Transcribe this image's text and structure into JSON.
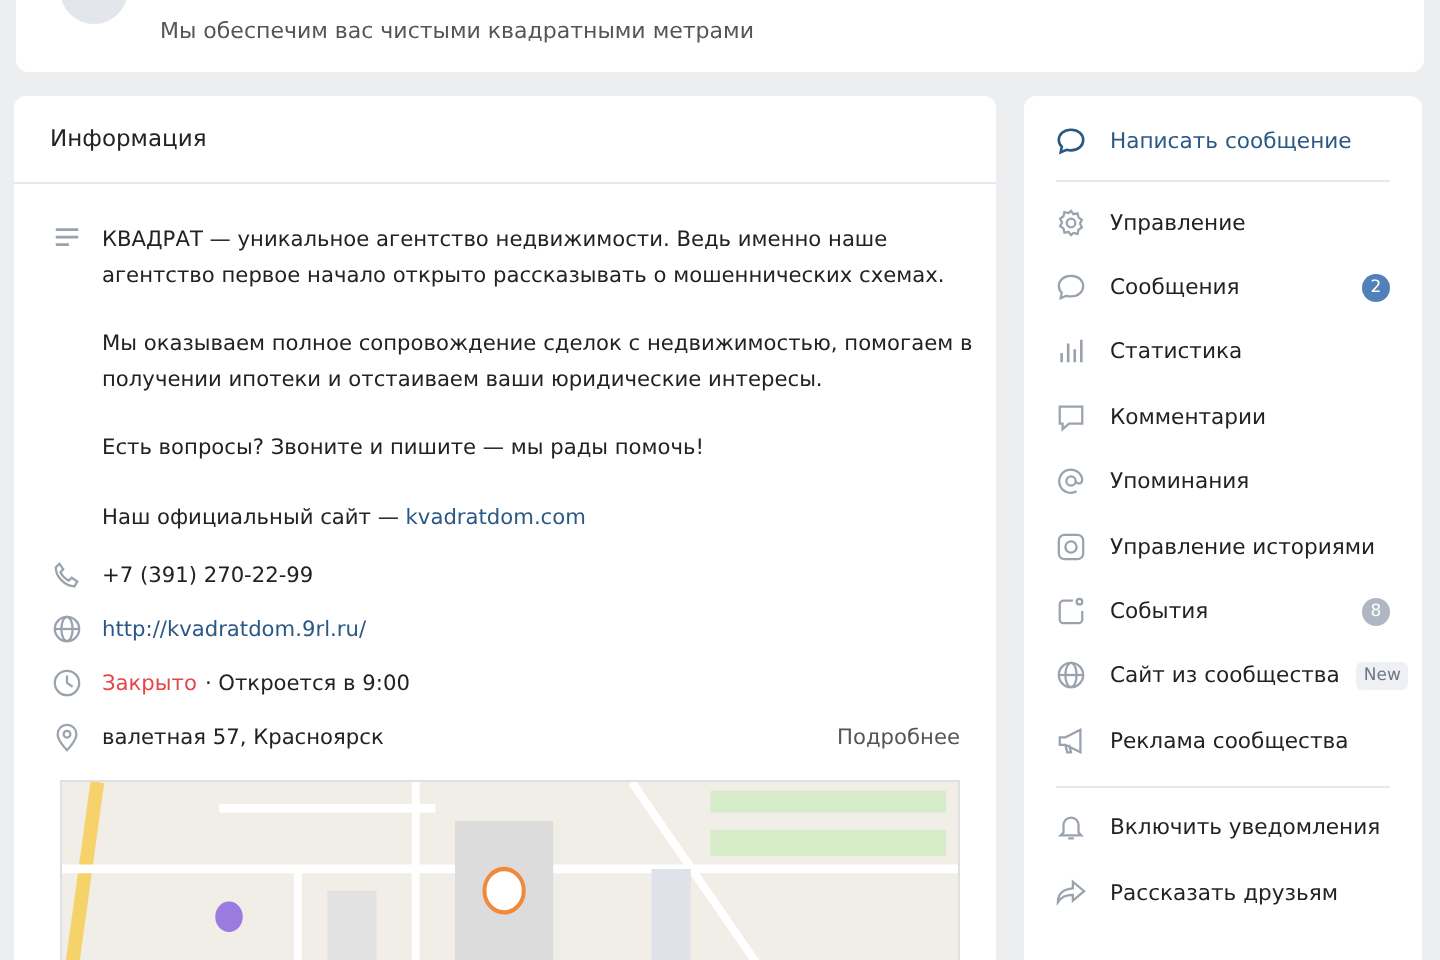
{
  "header": {
    "subtitle": "Мы обеспечим вас чистыми квадратными метрами"
  },
  "info": {
    "title": "Информация",
    "paragraphs": [
      "КВАДРАТ — уникальное агентство недвижимости. Ведь именно наше агентство первое начало открыто рассказывать о мошеннических схемах.",
      "Мы оказываем полное сопровождение сделок с недвижимостью, помогаем в получении ипотеки и отстаиваем ваши юридические интересы.",
      "Есть вопросы? Звоните и пишите — мы рады помочь!"
    ],
    "site_label": "Наш официальный сайт —",
    "site_link": "kvadratdom.com",
    "contacts": [
      {
        "kind": "phone",
        "text": "+7 (391) 270-22-99"
      },
      {
        "kind": "web",
        "text": "http://kvadratdom.9rl.ru/"
      },
      {
        "kind": "hours",
        "status": "Закрыто",
        "text": "· Откроется в 9:00"
      },
      {
        "kind": "address",
        "text": "валетная 57, Красноярск",
        "more": "Подробнее"
      }
    ]
  },
  "menu": {
    "primary": {
      "label": "Написать сообщение"
    },
    "groups": [
      [
        {
          "kind": "gear",
          "label": "Управление"
        },
        {
          "kind": "chat",
          "label": "Сообщения",
          "badge": {
            "kind": "count",
            "text": "2"
          }
        },
        {
          "kind": "chart",
          "label": "Статистика"
        },
        {
          "kind": "comment",
          "label": "Комментарии"
        },
        {
          "kind": "at",
          "label": "Упоминания"
        },
        {
          "kind": "stories",
          "label": "Управление историями"
        },
        {
          "kind": "events",
          "label": "События",
          "badge": {
            "kind": "muted",
            "text": "8"
          }
        },
        {
          "kind": "globe",
          "label": "Сайт из сообщества",
          "badge": {
            "kind": "new",
            "text": "New"
          }
        },
        {
          "kind": "megaphone",
          "label": "Реклама сообщества"
        }
      ],
      [
        {
          "kind": "bell",
          "label": "Включить уведомления"
        },
        {
          "kind": "share",
          "label": "Рассказать друзьям"
        }
      ]
    ]
  }
}
